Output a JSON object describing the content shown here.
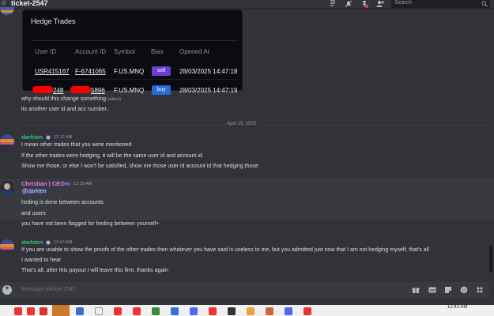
{
  "header": {
    "channel": "ticket-2547",
    "search_placeholder": "Search"
  },
  "trades_image": {
    "title": "Hedge Trades",
    "columns": [
      "User ID",
      "Account ID",
      "Symbol",
      "Bias",
      "Opened At"
    ],
    "rows": [
      {
        "user_id": "USR415167",
        "account_id": "F-6741065",
        "symbol": "F.US.MNQ",
        "bias": "sell",
        "opened_at": "28/03/2025 14:47:18"
      },
      {
        "user_id": "248",
        "account_id": "5896",
        "symbol": "F.US.MNQ",
        "bias": "buy",
        "opened_at": "28/03/2025 14:47:19"
      }
    ],
    "colors": {
      "sell": "#6c3bd1",
      "buy": "#2a6ad6",
      "redaction": "#ff0000"
    }
  },
  "messages_top": [
    {
      "text": "why should this change something",
      "edited": "(edited)"
    },
    {
      "text": "its another user id and acc number.."
    }
  ],
  "date_divider": "April 15, 2025",
  "groups": [
    {
      "author": "darkten",
      "author_color": "#2dc770",
      "time": "12:12 AM",
      "lines": [
        "I mean other trades that you were mentioned",
        "If the other trades were hedging, it will be the same user id and account id",
        "Show me those, or else I won't be satisfied, show me those user id account id that hedging those"
      ]
    },
    {
      "author": "Christian | CEO",
      "author_color": "#e879f9",
      "time": "12:39 AM",
      "mention": "@darkten",
      "lines": [
        "heding is done between accounts",
        "and users",
        "you have not been flagged for heding between yourself+"
      ]
    },
    {
      "author": "darkten",
      "author_color": "#2dc770",
      "time": "12:43 AM",
      "lines": [
        "If you are unable to show the proofs of the other trades then whatever you have said is useless to me, but you admitted just now that I am not hedging myself, that's all",
        "I wanted to hear",
        "That's all, after this payout I will leave this firm, thanks again"
      ]
    }
  ],
  "composer": {
    "placeholder": "Message #ticket-2547"
  },
  "taskbar": {
    "time": "12:43 AM"
  }
}
